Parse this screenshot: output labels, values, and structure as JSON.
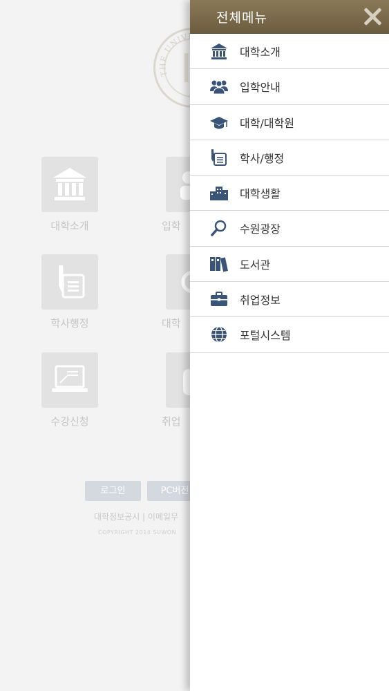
{
  "background": {
    "seal_text": "THE UNIVERS",
    "tiles": [
      {
        "label": "대학소개"
      },
      {
        "label": "입학"
      },
      {
        "label": "학사행정"
      },
      {
        "label": "대학"
      },
      {
        "label": "수강신청"
      },
      {
        "label": "취업"
      }
    ],
    "login_button": "로그인",
    "pc_button": "PC버전",
    "footer_links": "대학정보공시 | 이메일무",
    "copyright": "COPYRIGHT 2014 SUWON"
  },
  "menu": {
    "title": "전체메뉴",
    "items": [
      {
        "label": "대학소개",
        "icon": "university-building-icon"
      },
      {
        "label": "입학안내",
        "icon": "people-group-icon"
      },
      {
        "label": "대학/대학원",
        "icon": "graduation-cap-icon"
      },
      {
        "label": "학사/행정",
        "icon": "document-pen-icon"
      },
      {
        "label": "대학생활",
        "icon": "campus-buildings-icon"
      },
      {
        "label": "수원광장",
        "icon": "magnifier-icon"
      },
      {
        "label": "도서관",
        "icon": "books-icon"
      },
      {
        "label": "취업정보",
        "icon": "briefcase-icon"
      },
      {
        "label": "포털시스템",
        "icon": "globe-icon"
      }
    ]
  },
  "colors": {
    "header": "#7a6a4c",
    "icon": "#3a5478",
    "background": "#f3f3f3"
  }
}
